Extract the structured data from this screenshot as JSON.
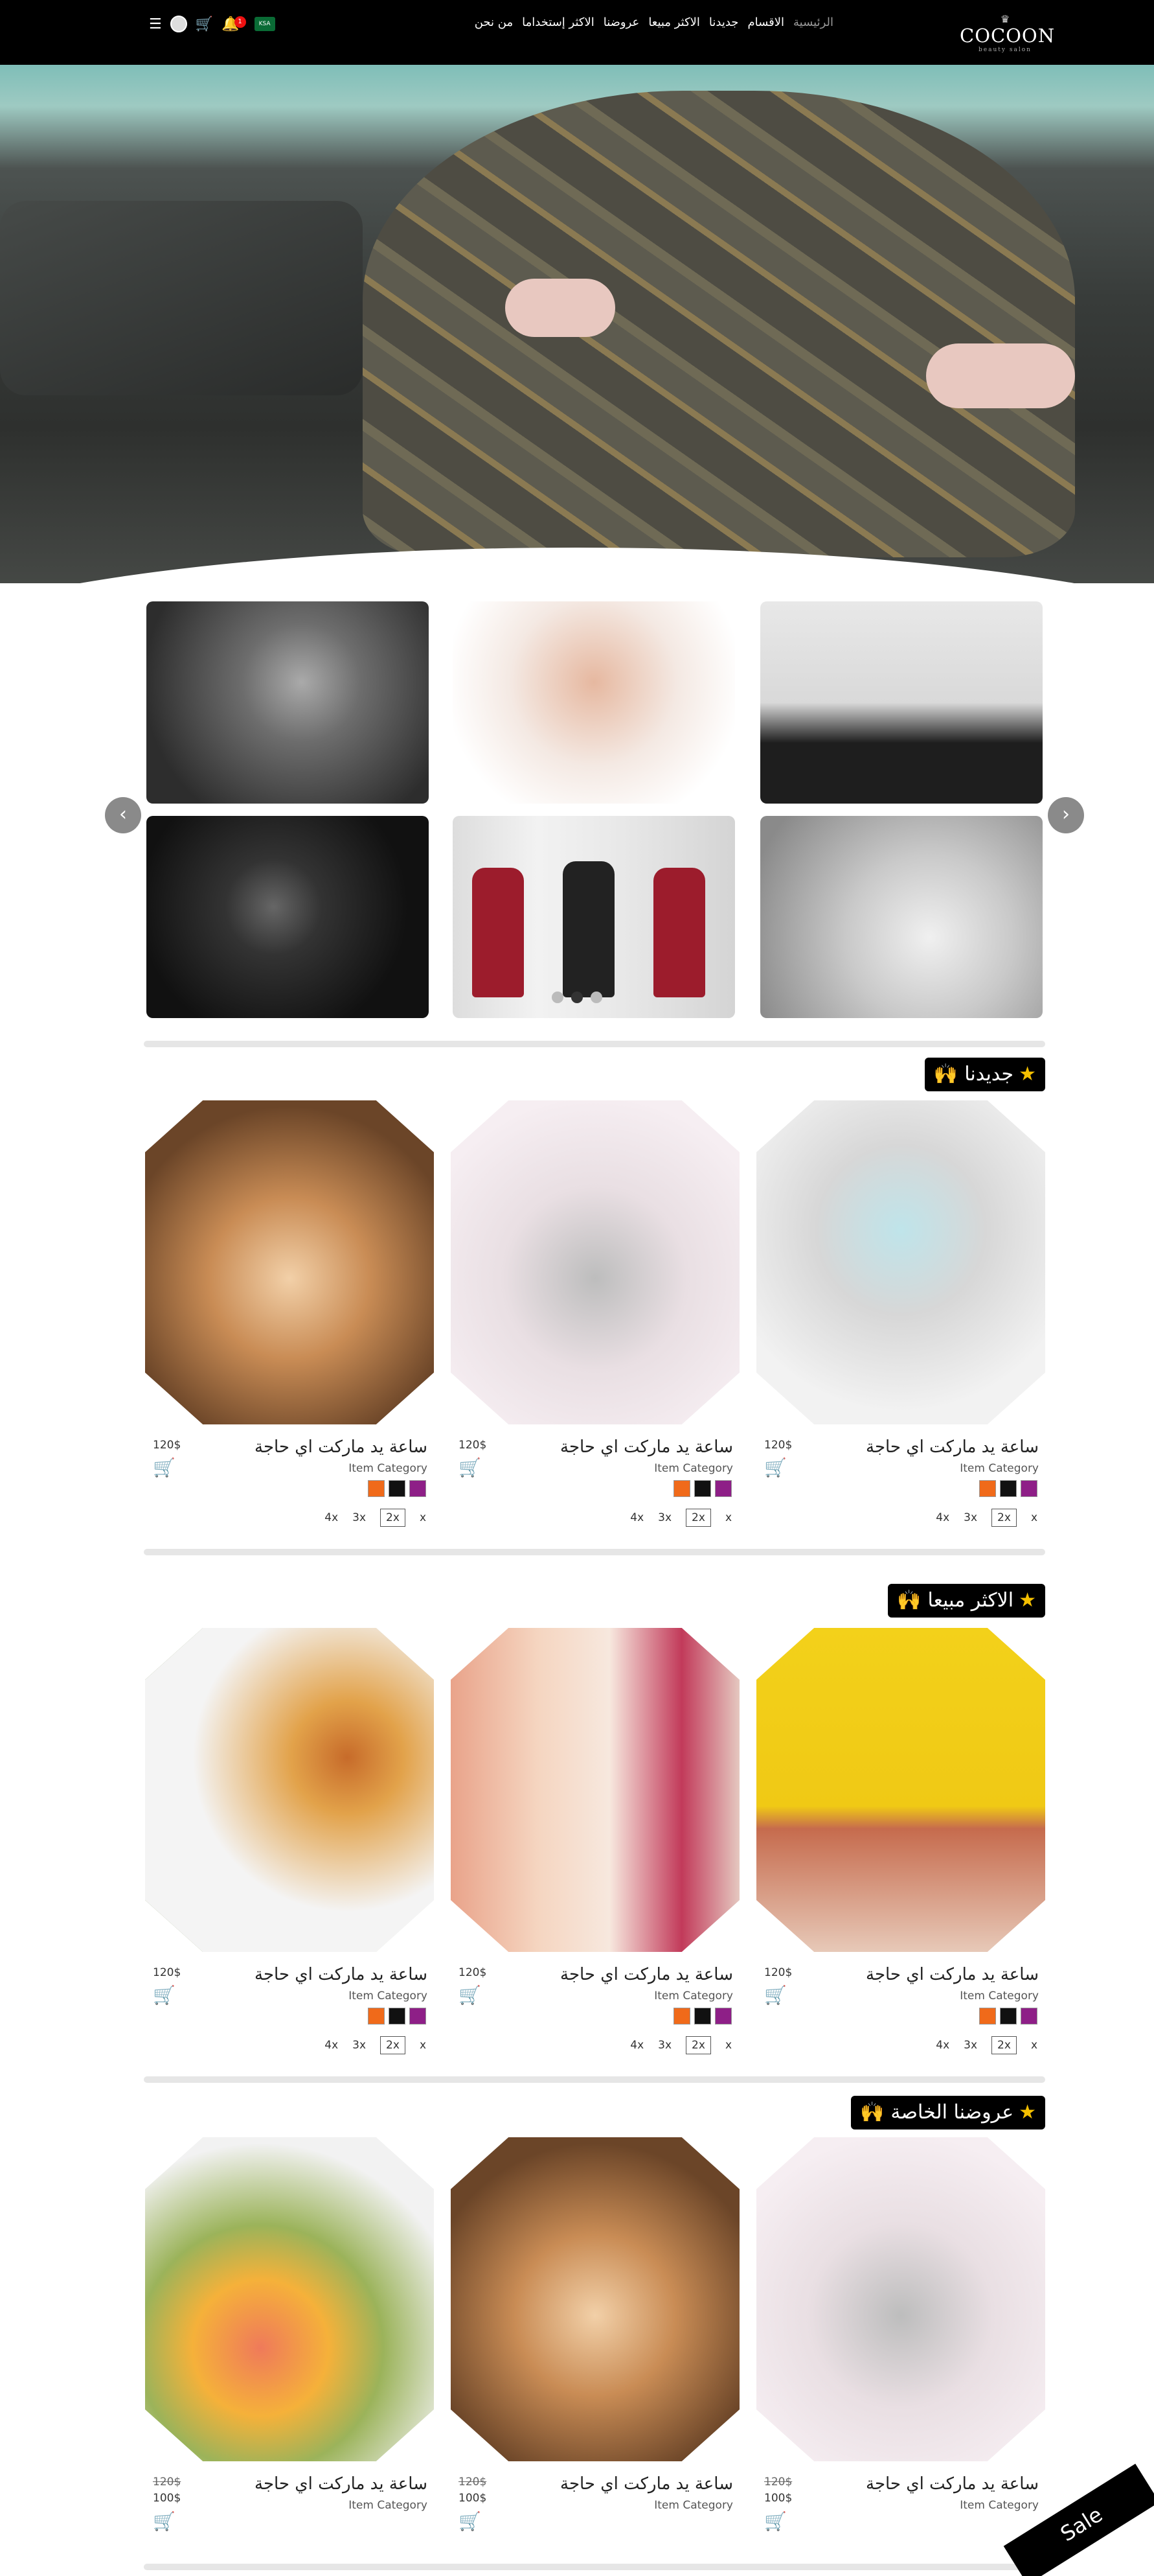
{
  "nav": {
    "logo_crown": "♛",
    "logo_name": "COCOON",
    "logo_tag": "beauty salon",
    "menu": [
      "الرئيسية",
      "الاقسام",
      "جديدنا",
      "الاكثر مبيعا",
      "عروضنا",
      "الاكثر إستخداما",
      "من نحن"
    ],
    "flag_label": "KSA",
    "notif_count": "1"
  },
  "colors": {
    "purple": "#8e1f87",
    "black": "#111111",
    "orange": "#f06a1a"
  },
  "sections": [
    {
      "title": "جديدنا",
      "products": [
        {
          "name": "ساعة يد ماركت اي حاجة",
          "category": "Item Category",
          "price": "120$"
        },
        {
          "name": "ساعة يد ماركت اي حاجة",
          "category": "Item Category",
          "price": "120$"
        },
        {
          "name": "ساعة يد ماركت اي حاجة",
          "category": "Item Category",
          "price": "120$"
        }
      ]
    },
    {
      "title": "الاكثر مبيعا",
      "products": [
        {
          "name": "ساعة يد ماركت اي حاجة",
          "category": "Item Category",
          "price": "120$"
        },
        {
          "name": "ساعة يد ماركت اي حاجة",
          "category": "Item Category",
          "price": "120$"
        },
        {
          "name": "ساعة يد ماركت اي حاجة",
          "category": "Item Category",
          "price": "120$"
        }
      ]
    },
    {
      "title": "عروضنا الخاصة",
      "products": [
        {
          "name": "ساعة يد ماركت اي حاجة",
          "category": "Item Category",
          "old_price": "120$",
          "new_price": "100$"
        },
        {
          "name": "ساعة يد ماركت اي حاجة",
          "category": "Item Category",
          "old_price": "120$",
          "new_price": "100$"
        },
        {
          "name": "ساعة يد ماركت اي حاجة",
          "category": "Item Category",
          "old_price": "120$",
          "new_price": "100$"
        }
      ]
    }
  ],
  "sizes": [
    "4x",
    "3x",
    "2x",
    "x"
  ],
  "sale_label": "Sale"
}
